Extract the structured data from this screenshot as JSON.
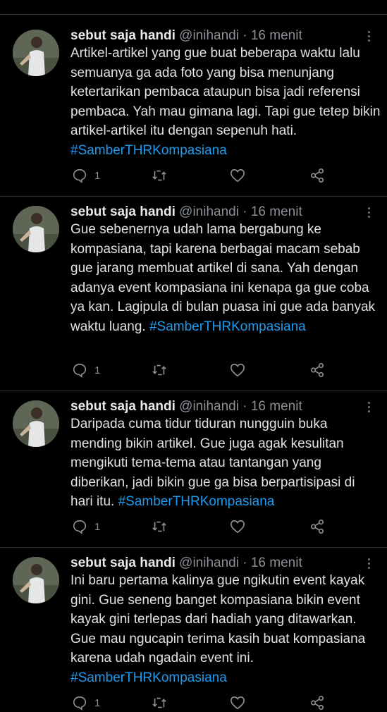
{
  "tweets": [
    {
      "name": "sebut saja handi",
      "handle": "@inihandi",
      "sep": "·",
      "time": "16 menit",
      "text": "Artikel-artikel yang gue buat beberapa waktu lalu semuanya ga ada foto yang bisa menunjang ketertarikan pembaca ataupun bisa jadi referensi pembaca. Yah mau gimana lagi. Tapi gue tetep bikin artikel-artikel itu dengan sepenuh hati.",
      "hashtag": "#SamberTHRKompasiana",
      "replies": "1"
    },
    {
      "name": "sebut saja handi",
      "handle": "@inihandi",
      "sep": "·",
      "time": "16 menit",
      "text": "Gue sebenernya udah lama bergabung ke kompasiana, tapi karena berbagai macam sebab gue jarang membuat artikel di sana. Yah dengan adanya event kompasiana ini kenapa ga gue coba ya kan. Lagipula di bulan puasa ini gue ada banyak waktu luang.",
      "hashtag": "#SamberTHRKompasiana",
      "replies": "1"
    },
    {
      "name": "sebut saja handi",
      "handle": "@inihandi",
      "sep": "·",
      "time": "16 menit",
      "text": "Daripada cuma tidur tiduran nungguin buka mending bikin artikel. Gue juga agak kesulitan mengikuti tema-tema atau tantangan yang diberikan, jadi bikin gue ga bisa berpartisipasi di hari itu.",
      "hashtag": "#SamberTHRKompasiana",
      "replies": "1"
    },
    {
      "name": "sebut saja handi",
      "handle": "@inihandi",
      "sep": "·",
      "time": "16 menit",
      "text": "Ini baru pertama kalinya gue ngikutin event kayak gini. Gue seneng banget kompasiana bikin event kayak gini terlepas dari hadiah yang ditawarkan. Gue mau ngucapin terima kasih buat kompasiana karena udah ngadain event ini.",
      "hashtag": "#SamberTHRKompasiana",
      "replies": "1"
    }
  ],
  "colors": {
    "hashtag": "#1d9bf0",
    "meta": "#8b9096",
    "background": "#000000"
  },
  "icons": [
    "reply-icon",
    "retweet-icon",
    "like-icon",
    "share-icon",
    "more-options-icon"
  ]
}
